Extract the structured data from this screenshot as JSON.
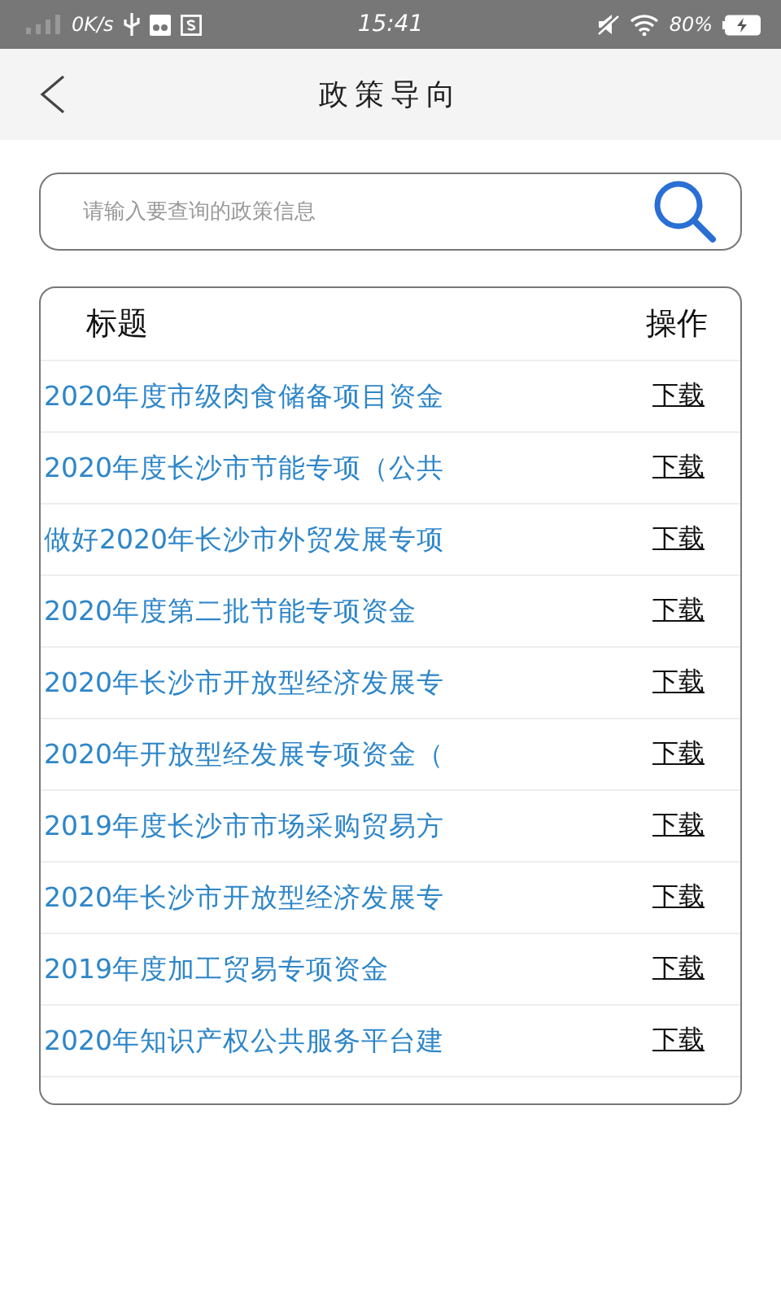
{
  "status_bar": {
    "speed": "0K/s",
    "time": "15:41",
    "battery": "80%"
  },
  "header": {
    "title": "政策导向"
  },
  "search": {
    "placeholder": "请输入要查询的政策信息"
  },
  "table": {
    "columns": [
      "标题",
      "操作"
    ],
    "rows": [
      {
        "title": "2020年度市级肉食储备项目资金",
        "action": "下载"
      },
      {
        "title": "2020年度长沙市节能专项（公共",
        "action": "下载"
      },
      {
        "title": "做好2020年长沙市外贸发展专项",
        "action": "下载"
      },
      {
        "title": "2020年度第二批节能专项资金",
        "action": "下载"
      },
      {
        "title": "2020年长沙市开放型经济发展专",
        "action": "下载"
      },
      {
        "title": "2020年开放型经发展专项资金（",
        "action": "下载"
      },
      {
        "title": "2019年度长沙市市场采购贸易方",
        "action": "下载"
      },
      {
        "title": "2020年长沙市开放型经济发展专",
        "action": "下载"
      },
      {
        "title": "2019年度加工贸易专项资金",
        "action": "下载"
      },
      {
        "title": "2020年知识产权公共服务平台建",
        "action": "下载"
      }
    ]
  }
}
